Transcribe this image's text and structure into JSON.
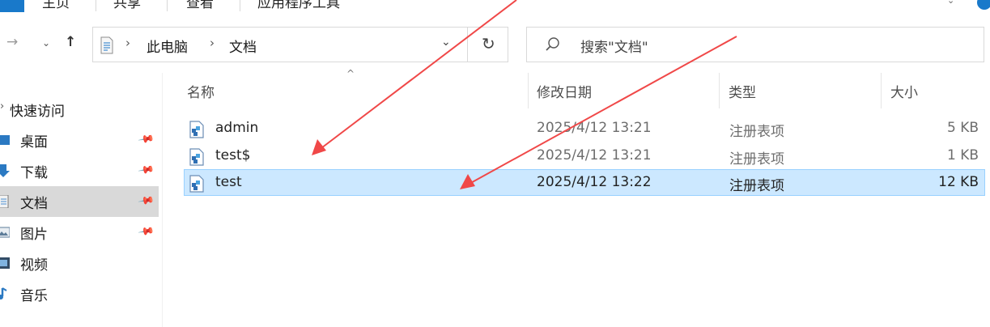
{
  "ribbon": {
    "tabs": [
      "主页",
      "共享",
      "查看",
      "应用程序工具"
    ]
  },
  "address": {
    "crumbs": [
      "此电脑",
      "文档"
    ],
    "separator": "›",
    "search_placeholder": "搜索\"文档\""
  },
  "nav_pane": {
    "quick_access": "快速访问",
    "items": [
      {
        "label": "桌面",
        "icon": "desktop-icon",
        "pinned": true
      },
      {
        "label": "下载",
        "icon": "download-icon",
        "pinned": true
      },
      {
        "label": "文档",
        "icon": "documents-icon",
        "pinned": true,
        "selected": true
      },
      {
        "label": "图片",
        "icon": "pictures-icon",
        "pinned": true
      },
      {
        "label": "视频",
        "icon": "videos-icon",
        "pinned": false
      },
      {
        "label": "音乐",
        "icon": "music-icon",
        "pinned": false
      }
    ]
  },
  "file_list": {
    "columns": [
      "名称",
      "修改日期",
      "类型",
      "大小"
    ],
    "rows": [
      {
        "name": "admin",
        "modified": "2025/4/12 13:21",
        "type": "注册表项",
        "size": "5 KB",
        "selected": false
      },
      {
        "name": "test$",
        "modified": "2025/4/12 13:21",
        "type": "注册表项",
        "size": "1 KB",
        "selected": false
      },
      {
        "name": "test",
        "modified": "2025/4/12 13:22",
        "type": "注册表项",
        "size": "12 KB",
        "selected": true
      }
    ]
  },
  "colors": {
    "accent": "#1979ca",
    "selection_bg": "#cce8ff",
    "selection_border": "#99d1ff",
    "annotation_arrow": "#f04848"
  }
}
